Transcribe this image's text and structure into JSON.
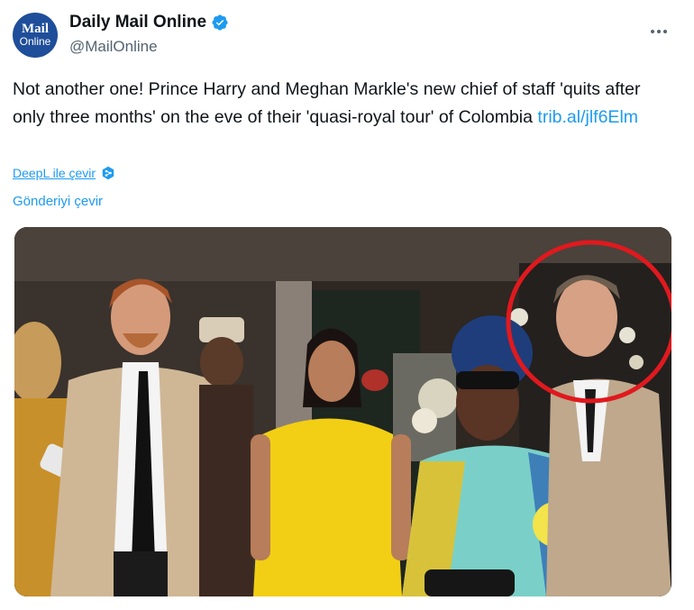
{
  "account": {
    "avatar_line1": "Mail",
    "avatar_line2": "Online",
    "display_name": "Daily Mail Online",
    "handle": "@MailOnline",
    "verified_icon": "verified-badge-icon"
  },
  "menu_icon": "more-options-icon",
  "tweet": {
    "text": "Not another one! Prince Harry and Meghan Markle's new chief of staff 'quits after only three months' on the eve of their 'quasi-royal tour' of Colombia ",
    "link": "trib.al/jlf6Elm"
  },
  "deepl": {
    "label": "DeepL ile çevir",
    "icon": "deepl-icon"
  },
  "translate_label": "Gönderiyi çevir",
  "media": {
    "highlight_color": "#e0191e"
  },
  "colors": {
    "link": "#1d9bf0",
    "text": "#0f1419",
    "secondary": "#536471",
    "verified": "#1d9bf0"
  }
}
